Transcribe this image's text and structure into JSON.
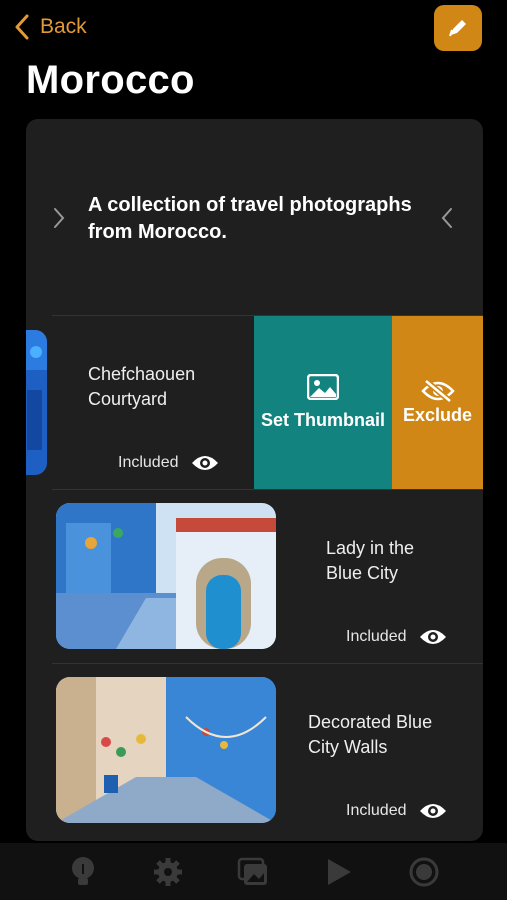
{
  "nav": {
    "back_label": "Back",
    "edit_icon": "pencil-icon"
  },
  "page": {
    "title": "Morocco"
  },
  "album": {
    "description": "A collection of travel photographs from Morocco."
  },
  "photos": [
    {
      "name": "Chefchaouen Courtyard",
      "status": "Included",
      "swiped": true
    },
    {
      "name": "Lady in the Blue City",
      "status": "Included",
      "swiped": false
    },
    {
      "name": "Decorated Blue City Walls",
      "status": "Included",
      "swiped": false
    }
  ],
  "swipe_actions": {
    "set_thumbnail": "Set Thumbnail",
    "exclude": "Exclude"
  },
  "tabs": [
    "lightbulb-icon",
    "gear-icon",
    "photos-icon",
    "play-icon",
    "aperture-icon"
  ],
  "colors": {
    "accent": "#d08716",
    "teal": "#12837f",
    "card": "#1f1f1f"
  }
}
